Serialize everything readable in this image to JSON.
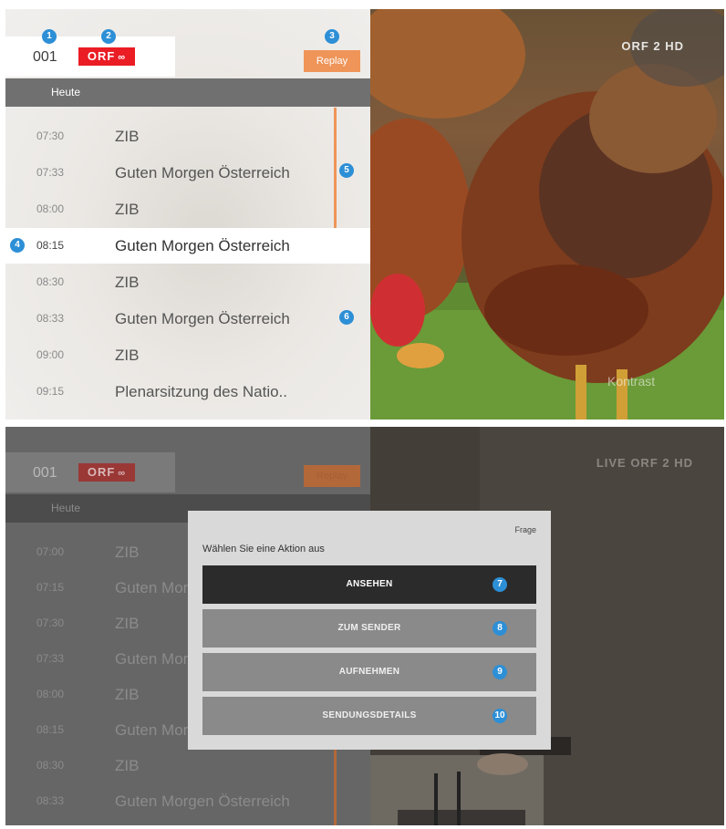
{
  "top": {
    "channel_number": "001",
    "channel_logo": "ORF",
    "channel_logo_suffix": "∞",
    "replay_label": "Replay",
    "day_label": "Heute",
    "programs": [
      {
        "time": "07:30",
        "title": "ZIB"
      },
      {
        "time": "07:33",
        "title": "Guten Morgen Österreich"
      },
      {
        "time": "08:00",
        "title": "ZIB"
      },
      {
        "time": "08:15",
        "title": "Guten Morgen Österreich"
      },
      {
        "time": "08:30",
        "title": "ZIB"
      },
      {
        "time": "08:33",
        "title": "Guten Morgen Österreich"
      },
      {
        "time": "09:00",
        "title": "ZIB"
      },
      {
        "time": "09:15",
        "title": "Plenarsitzung des Natio.."
      }
    ],
    "video_watermark": "ORF 2 HD",
    "video_corner_text": "Kontrast"
  },
  "bottom": {
    "channel_number": "001",
    "channel_logo": "ORF",
    "channel_logo_suffix": "∞",
    "replay_label": "Replay",
    "day_label": "Heute",
    "programs": [
      {
        "time": "07:00",
        "title": "ZIB"
      },
      {
        "time": "07:15",
        "title": "Guten Mor"
      },
      {
        "time": "07:30",
        "title": "ZIB"
      },
      {
        "time": "07:33",
        "title": "Guten Mor"
      },
      {
        "time": "08:00",
        "title": "ZIB"
      },
      {
        "time": "08:15",
        "title": "Guten Mor"
      },
      {
        "time": "08:30",
        "title": "ZIB"
      },
      {
        "time": "08:33",
        "title": "Guten Morgen Österreich"
      }
    ],
    "video_watermark": "LIVE ORF 2 HD",
    "dialog": {
      "tag": "Frage",
      "prompt": "Wählen Sie eine Aktion aus",
      "options": [
        "ANSEHEN",
        "ZUM SENDER",
        "AUFNEHMEN",
        "SENDUNGSDETAILS"
      ]
    }
  },
  "markers": [
    "1",
    "2",
    "3",
    "4",
    "5",
    "6",
    "7",
    "8",
    "9",
    "10"
  ],
  "colors": {
    "accent_orange": "#ef9559",
    "orf_red": "#ea1c24",
    "marker_blue": "#2d8fd6",
    "selected_row": "#ffffff",
    "primary_button": "#2b2b2b"
  }
}
